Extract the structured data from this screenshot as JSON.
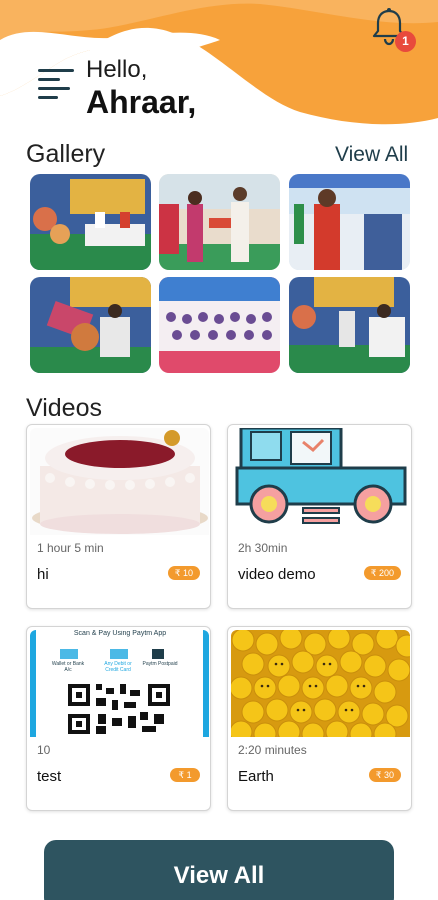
{
  "header": {
    "greeting": "Hello,",
    "user_name": "Ahraar,",
    "notification_count": "1",
    "accent_color": "#f7a23b"
  },
  "gallery": {
    "title": "Gallery",
    "view_all_label": "View All",
    "images": [
      {
        "subject": "stage-ceremony"
      },
      {
        "subject": "award-presentation"
      },
      {
        "subject": "speaker-at-podium"
      },
      {
        "subject": "honoring-guest"
      },
      {
        "subject": "seated-audience"
      },
      {
        "subject": "dignitaries-seated"
      }
    ]
  },
  "videos": {
    "title": "Videos",
    "items": [
      {
        "duration": "1 hour 5 min",
        "title": "hi",
        "price": "₹ 10",
        "thumb": "cake"
      },
      {
        "duration": "2h 30min",
        "title": "video demo",
        "price": "₹ 200",
        "thumb": "train"
      },
      {
        "duration": "10",
        "title": "test",
        "price": "₹ 1",
        "thumb": "qr-code"
      },
      {
        "duration": "2:20 minutes",
        "title": "Earth",
        "price": "₹ 30",
        "thumb": "yellow-heads"
      }
    ],
    "qr_thumb_text": {
      "heading": "Scan & Pay Using Paytm App",
      "option1": "Wallet or Bank A/c",
      "option2": "Any Debit or Credit Card",
      "option3": "Paytm Postpaid"
    }
  },
  "footer": {
    "view_all_button": "View All",
    "button_color": "#2e5460"
  }
}
